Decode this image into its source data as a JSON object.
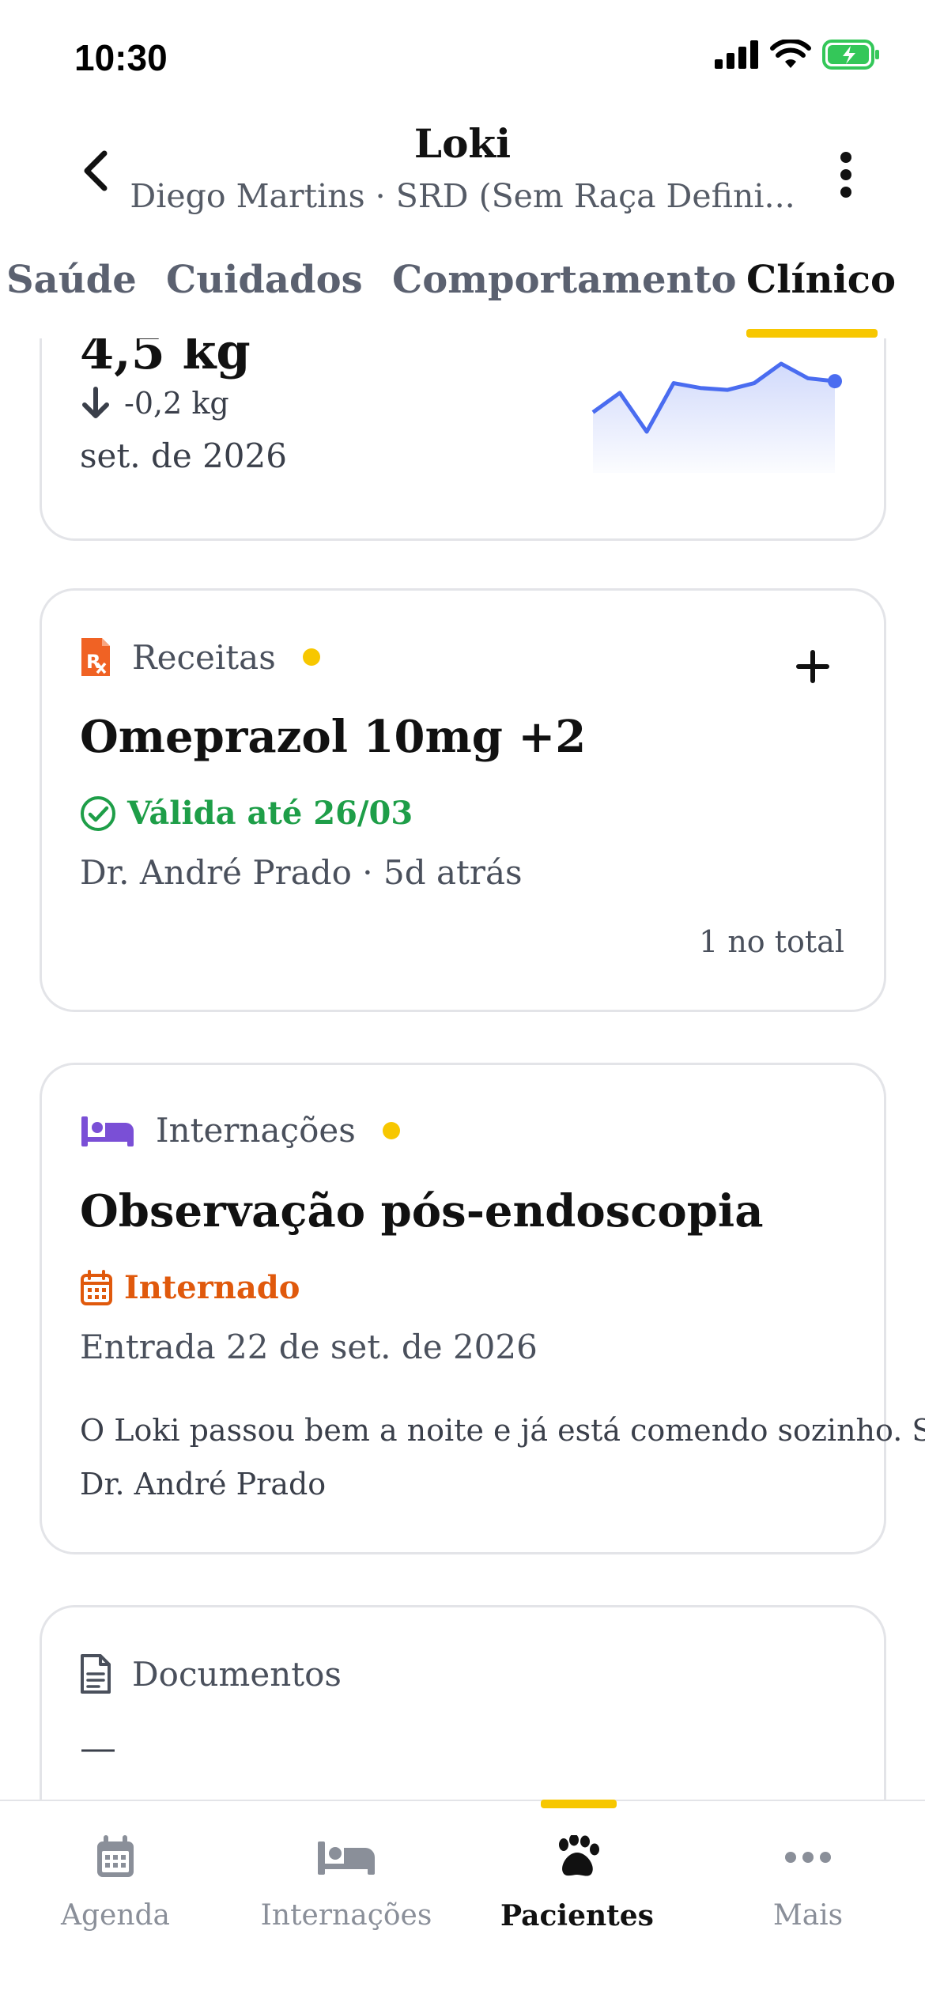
{
  "status_bar": {
    "time": "10:30"
  },
  "header": {
    "title": "Loki",
    "subtitle": "Diego Martins · SRD (Sem Raça Defini..."
  },
  "tabs": [
    {
      "label": "Saúde",
      "active": false
    },
    {
      "label": "Cuidados",
      "active": false
    },
    {
      "label": "Comportamento",
      "active": false
    },
    {
      "label": "Clínico",
      "active": true
    }
  ],
  "weight_card": {
    "value": "4,5 kg",
    "delta": "-0,2 kg",
    "date": "set. de 2026",
    "trend_series": [
      0.7,
      0.9,
      0.5,
      1.0,
      0.95,
      0.93,
      1.0,
      1.2,
      1.05,
      1.02
    ]
  },
  "prescriptions_card": {
    "heading": "Receitas",
    "title": "Omeprazol 10mg +2",
    "status": "Válida até 26/03",
    "meta": "Dr. André Prado · 5d atrás",
    "total": "1 no total"
  },
  "hospitalizations_card": {
    "heading": "Internações",
    "title": "Observação pós-endoscopia",
    "status": "Internado",
    "entry": "Entrada 22 de set. de 2026",
    "note": "O Loki passou bem a noite e já está comendo sozinho. Se...",
    "author": "Dr. André Prado"
  },
  "documents_card": {
    "heading": "Documentos",
    "placeholder": "—"
  },
  "bottom_nav": [
    {
      "label": "Agenda",
      "icon": "calendar-icon",
      "active": false
    },
    {
      "label": "Internações",
      "icon": "bed-icon",
      "active": false
    },
    {
      "label": "Pacientes",
      "icon": "paw-icon",
      "active": true
    },
    {
      "label": "Mais",
      "icon": "more-horizontal-icon",
      "active": false
    }
  ],
  "colors": {
    "accent": "#f7c700",
    "success": "#1e9e48",
    "warning": "#e0590c",
    "rx_icon": "#f06224",
    "bed_icon": "#7a4fd6",
    "chart_line": "#4a6cf0"
  }
}
